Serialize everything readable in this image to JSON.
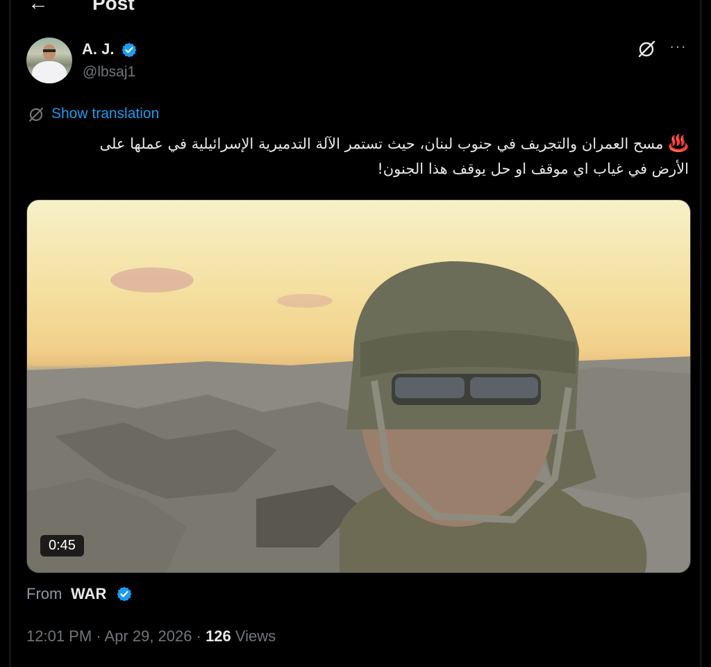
{
  "header": {
    "title": "Post",
    "back_icon": "arrow-left-icon"
  },
  "author": {
    "name": "A. J.",
    "handle": "@lbsaj1",
    "verified": true
  },
  "actions": {
    "grok_icon": "grok-icon",
    "more_icon": "more-icon",
    "more_label": "···"
  },
  "translation": {
    "label": "Show translation"
  },
  "post": {
    "emoji": "♨️",
    "text": "مسح العمران والتجريف في جنوب لبنان، حيث تستمر الآلة التدميرية الإسرائيلية في عملها على الأرض في غياب اي موقف او حل يوقف هذا الجنون!"
  },
  "media": {
    "duration": "0:45",
    "type": "video"
  },
  "source": {
    "from_label": "From",
    "name": "WAR",
    "verified": true
  },
  "meta": {
    "time": "12:01 PM",
    "sep1": " · ",
    "date": "Apr 29, 2026",
    "sep2": " · ",
    "views_count": "126",
    "views_label": " Views"
  },
  "colors": {
    "accent": "#1d9bf0",
    "background": "#000000",
    "secondary_text": "#71767b"
  }
}
